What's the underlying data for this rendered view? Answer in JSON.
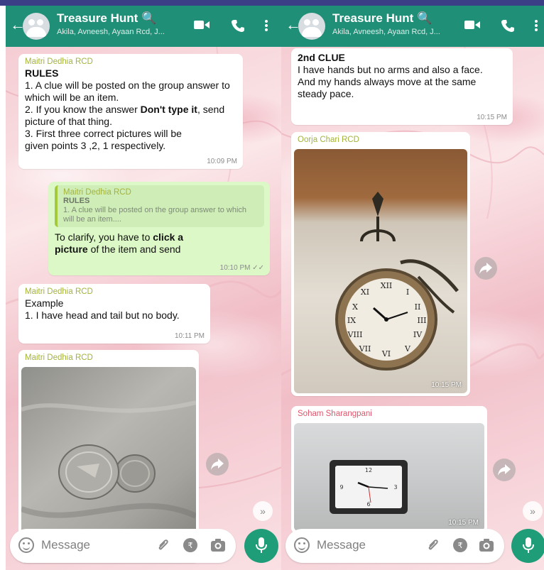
{
  "left": {
    "header": {
      "title": "Treasure Hunt 🔍",
      "subtitle": "Akila, Avneesh, Ayaan Rcd, J..."
    },
    "messages": {
      "rules": {
        "sender": "Maitri Dedhia RCD",
        "title": "RULES",
        "line1": "1. A clue will be posted on the group answer to which will be an item.",
        "line2_pre": "2. If you know the answer ",
        "line2_bold": "Don't type it",
        "line2_post": ", send picture of that thing.",
        "line3": "3. First three correct pictures will be given points 3 ,2, 1 respectively.",
        "time": "10:09 PM"
      },
      "clarify": {
        "quote_sender": "Maitri Dedhia RCD",
        "quote_title": "RULES",
        "quote_text": "1. A clue will be posted on the group answer to which will be an item....",
        "text_pre": "To clarify, you have to ",
        "text_bold": "click a picture",
        "text_post": " of the item and send",
        "time": "10:10 PM ✓✓"
      },
      "example": {
        "sender": "Maitri Dedhia RCD",
        "line1": "Example",
        "line2": "1.  I have head and tail but no body.",
        "time": "10:11 PM"
      },
      "coin_image": {
        "sender": "Maitri Dedhia RCD"
      }
    },
    "composer": {
      "placeholder": "Message"
    }
  },
  "right": {
    "header": {
      "title": "Treasure Hunt 🔍",
      "subtitle": "Akila, Avneesh, Ayaan Rcd, J..."
    },
    "messages": {
      "clue2": {
        "title": "2nd CLUE",
        "line1": "I have hands but no arms and also a face.",
        "line2": "And my hands always move at the same steady pace.",
        "time": "10:15 PM"
      },
      "clock_image": {
        "sender": "Oorja Chari RCD",
        "time": "10:15 PM"
      },
      "wall_clock_image": {
        "sender": "Soham Sharangpani",
        "time": "10:15 PM"
      }
    },
    "composer": {
      "placeholder": "Message"
    }
  },
  "colors": {
    "header": "#1f8f77",
    "accent": "#1f9d78",
    "outgoing_bubble": "#dcf8c6",
    "sender_green": "#a4b33a",
    "sender_pink": "#e0556b"
  },
  "icons": [
    "back-arrow-icon",
    "group-avatar-icon",
    "video-call-icon",
    "phone-icon",
    "more-options-icon",
    "forward-icon",
    "scroll-down-icon",
    "emoji-icon",
    "attach-icon",
    "payment-icon",
    "camera-icon",
    "mic-icon"
  ]
}
